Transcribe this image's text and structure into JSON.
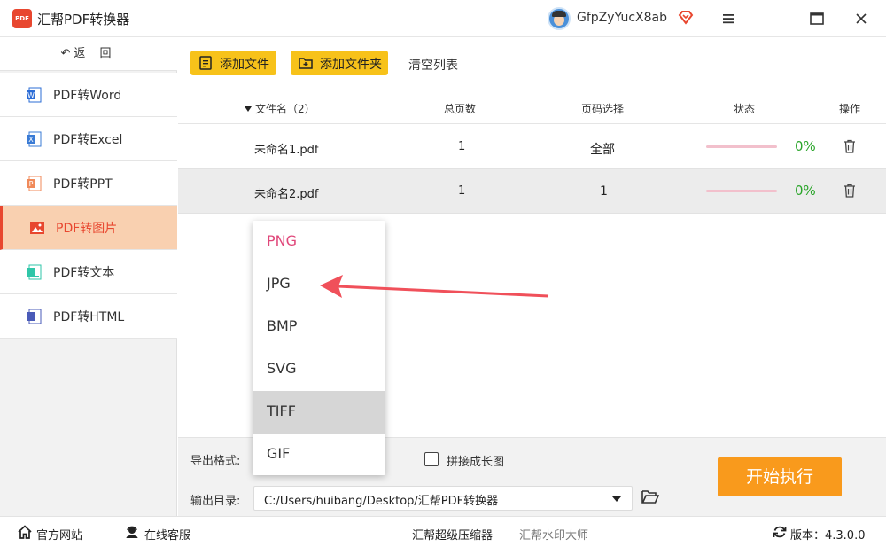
{
  "app": {
    "logo_text": "PDF",
    "title": "汇帮PDF转换器",
    "username": "GfpZyYucX8ab"
  },
  "sidebar": {
    "back_label": "返 回",
    "items": [
      {
        "label": "PDF转Word",
        "icon": "word-icon",
        "color": "#2b6cd6"
      },
      {
        "label": "PDF转Excel",
        "icon": "excel-icon",
        "color": "#3a7bd5"
      },
      {
        "label": "PDF转PPT",
        "icon": "ppt-icon",
        "color": "#f08a5a"
      },
      {
        "label": "PDF转图片",
        "icon": "image-icon",
        "color": "#e8472f",
        "active": true
      },
      {
        "label": "PDF转文本",
        "icon": "text-icon",
        "color": "#2fc6a8"
      },
      {
        "label": "PDF转HTML",
        "icon": "html-icon",
        "color": "#4a5bb8"
      }
    ]
  },
  "toolbar": {
    "add_file": "添加文件",
    "add_folder": "添加文件夹",
    "clear_list": "清空列表"
  },
  "table": {
    "headers": {
      "filename": "文件名（2）",
      "pages": "总页数",
      "range": "页码选择",
      "status": "状态",
      "actions": "操作"
    },
    "rows": [
      {
        "filename": "未命名1.pdf",
        "pages": "1",
        "range": "全部",
        "progress": 0,
        "percent": "0%"
      },
      {
        "filename": "未命名2.pdf",
        "pages": "1",
        "range": "1",
        "progress": 0,
        "percent": "0%"
      }
    ]
  },
  "format_dropdown": {
    "options": [
      "PNG",
      "JPG",
      "BMP",
      "SVG",
      "TIFF",
      "GIF"
    ],
    "selected": "PNG",
    "hovered": "TIFF"
  },
  "settings": {
    "format_label": "导出格式:",
    "stitch_label": "拼接成长图",
    "stitch_checked": false,
    "outdir_label": "输出目录:",
    "outdir_value": "C:/Users/huibang/Desktop/汇帮PDF转换器",
    "start_button": "开始执行"
  },
  "statusbar": {
    "website": "官方网站",
    "support": "在线客服",
    "compressor": "汇帮超级压缩器",
    "watermark": "汇帮水印大师",
    "version": "版本：4.3.0.0"
  },
  "colors": {
    "accent": "#e8472f",
    "toolbar_button": "#f7c21a",
    "start_button": "#f99a1c",
    "success": "#2aa52a",
    "selected_option": "#e0477a"
  }
}
